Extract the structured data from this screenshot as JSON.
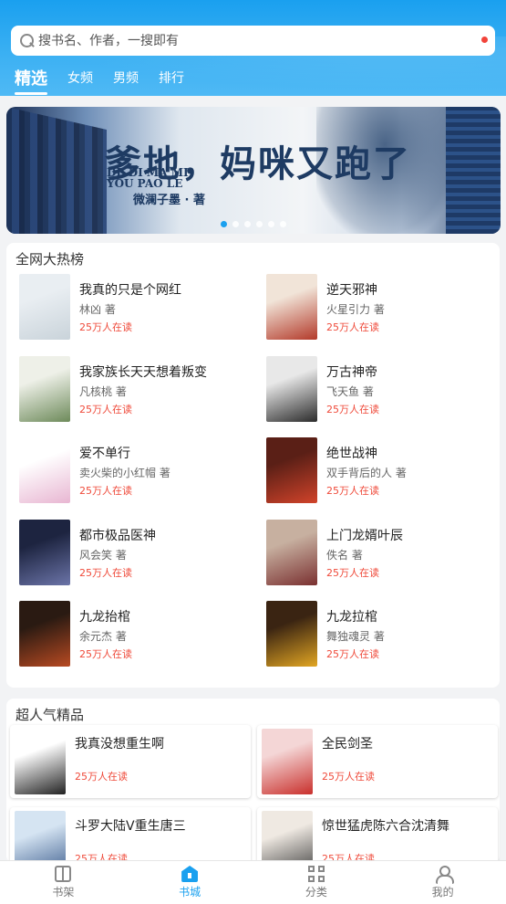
{
  "search": {
    "placeholder": "搜书名、作者，一搜即有"
  },
  "tabs": [
    {
      "label": "精选",
      "active": true
    },
    {
      "label": "女频",
      "active": false
    },
    {
      "label": "男频",
      "active": false
    },
    {
      "label": "排行",
      "active": false
    }
  ],
  "banner": {
    "title": "爹地，妈咪又跑了",
    "pinyin": "DE DI MA MI YOU PAO LE",
    "author": "微澜子墨 · 著",
    "dots_total": 6,
    "active_dot": 0
  },
  "hot": {
    "title": "全网大热榜",
    "books": [
      {
        "title": "我真的只是个网红",
        "author": "林凶 著",
        "readers": "25万人在读",
        "cover_colors": [
          "#e9eef2",
          "#c9d3da"
        ]
      },
      {
        "title": "逆天邪神",
        "author": "火星引力 著",
        "readers": "25万人在读",
        "cover_colors": [
          "#f1e4d8",
          "#b33a2a"
        ]
      },
      {
        "title": "我家族长天天想着叛变",
        "author": "凡核桃 著",
        "readers": "25万人在读",
        "cover_colors": [
          "#eef0e8",
          "#6d8a5a"
        ]
      },
      {
        "title": "万古神帝",
        "author": "飞天鱼 著",
        "readers": "25万人在读",
        "cover_colors": [
          "#e8e8e8",
          "#2b2b2b"
        ]
      },
      {
        "title": "爱不单行",
        "author": "卖火柴的小红帽 著",
        "readers": "25万人在读",
        "cover_colors": [
          "#ffffff",
          "#e8b6d2"
        ]
      },
      {
        "title": "绝世战神",
        "author": "双手背后的人 著",
        "readers": "25万人在读",
        "cover_colors": [
          "#5a1f16",
          "#d1432a"
        ]
      },
      {
        "title": "都市极品医神",
        "author": "风会笑 著",
        "readers": "25万人在读",
        "cover_colors": [
          "#1d2440",
          "#6b74a8"
        ]
      },
      {
        "title": "上门龙婿叶辰",
        "author": "佚名 著",
        "readers": "25万人在读",
        "cover_colors": [
          "#c7b0a0",
          "#7a3030"
        ]
      },
      {
        "title": "九龙抬棺",
        "author": "余元杰 著",
        "readers": "25万人在读",
        "cover_colors": [
          "#2a1a12",
          "#b84a22"
        ]
      },
      {
        "title": "九龙拉棺",
        "author": "舞独魂灵 著",
        "readers": "25万人在读",
        "cover_colors": [
          "#3a2412",
          "#e2a623"
        ]
      }
    ]
  },
  "popular": {
    "title": "超人气精品",
    "books": [
      {
        "title": "我真没想重生啊",
        "readers": "25万人在读",
        "cover_colors": [
          "#ffffff",
          "#222222"
        ]
      },
      {
        "title": "全民剑圣",
        "readers": "25万人在读",
        "cover_colors": [
          "#f4d6d6",
          "#c9302c"
        ]
      },
      {
        "title": "斗罗大陆V重生唐三",
        "readers": "25万人在读",
        "cover_colors": [
          "#d5e4f2",
          "#3a5b8c"
        ]
      },
      {
        "title": "惊世猛虎陈六合沈清舞",
        "readers": "25万人在读",
        "cover_colors": [
          "#efe9e2",
          "#3a3a3a"
        ]
      }
    ]
  },
  "bottom_nav": [
    {
      "label": "书架",
      "icon": "bookshelf-icon",
      "active": false
    },
    {
      "label": "书城",
      "icon": "bookstore-icon",
      "active": true
    },
    {
      "label": "分类",
      "icon": "category-grid-icon",
      "active": false
    },
    {
      "label": "我的",
      "icon": "user-icon",
      "active": false
    }
  ],
  "colors": {
    "accent": "#1aa0ef",
    "readers": "#ef4a3a",
    "header_top": "#1aa0ef"
  }
}
